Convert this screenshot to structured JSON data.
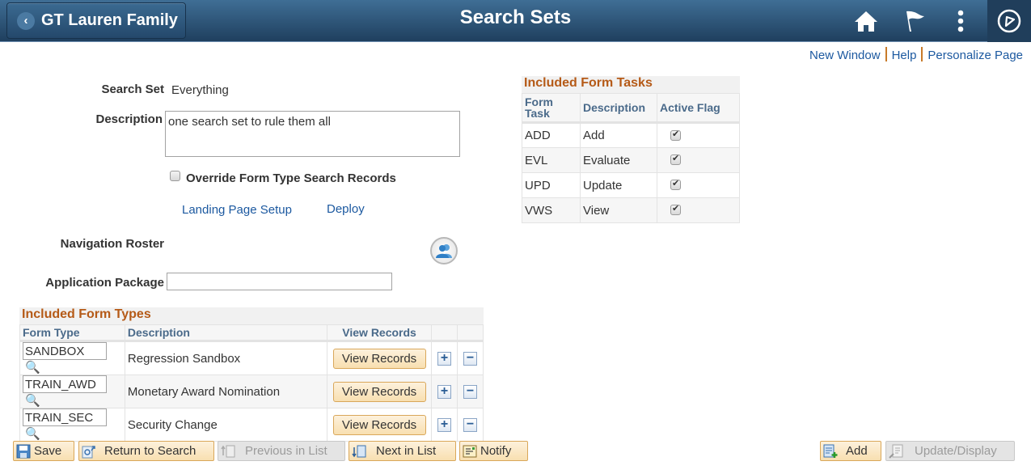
{
  "header": {
    "back_label": "GT Lauren Family",
    "title": "Search Sets",
    "icons": [
      "home-icon",
      "flag-icon",
      "more-vertical-icon",
      "navbar-compass-icon"
    ]
  },
  "util_links": [
    "New Window",
    "Help",
    "Personalize Page"
  ],
  "form": {
    "search_set_label": "Search Set",
    "search_set_value": "Everything",
    "description_label": "Description",
    "description_value": "one search set to rule them all",
    "override_label": "Override Form Type Search Records",
    "override_checked": false,
    "landing_page_link": "Landing Page Setup",
    "deploy_link": "Deploy",
    "nav_roster_label": "Navigation Roster",
    "app_package_label": "Application Package",
    "app_package_value": ""
  },
  "form_types": {
    "title": "Included Form Types",
    "columns": [
      "Form Type",
      "Description",
      "View Records"
    ],
    "rows": [
      {
        "form_type": "SANDBOX",
        "description": "Regression Sandbox",
        "button": "View Records"
      },
      {
        "form_type": "TRAIN_AWD",
        "description": "Monetary Award Nomination",
        "button": "View Records"
      },
      {
        "form_type": "TRAIN_SEC",
        "description": "Security Change",
        "button": "View Records"
      }
    ]
  },
  "form_tasks": {
    "title": "Included Form Tasks",
    "columns": [
      "Form Task",
      "Description",
      "Active Flag"
    ],
    "rows": [
      {
        "task": "ADD",
        "description": "Add",
        "active": true
      },
      {
        "task": "EVL",
        "description": "Evaluate",
        "active": true
      },
      {
        "task": "UPD",
        "description": "Update",
        "active": true
      },
      {
        "task": "VWS",
        "description": "View",
        "active": true
      }
    ]
  },
  "toolbar": {
    "save": "Save",
    "return_to_search": "Return to Search",
    "previous_in_list": "Previous in List",
    "next_in_list": "Next in List",
    "notify": "Notify",
    "add": "Add",
    "update_display": "Update/Display"
  }
}
